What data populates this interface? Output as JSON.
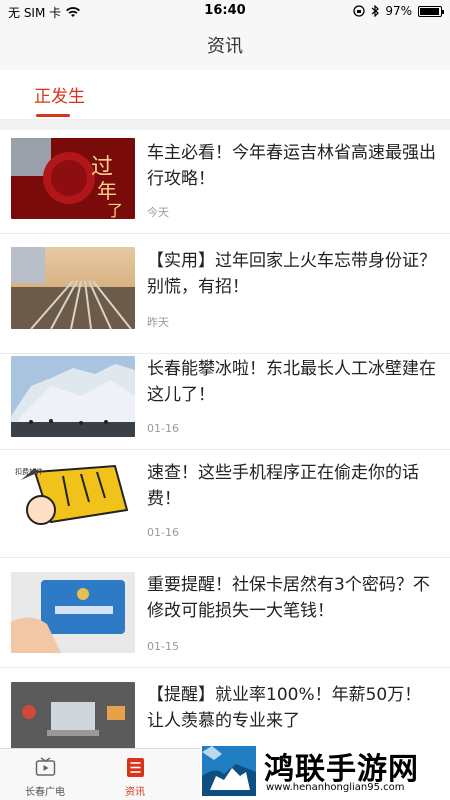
{
  "status_bar": {
    "carrier": "无 SIM 卡",
    "time": "16:40",
    "battery_percent_text": "97%",
    "battery_level": 0.97
  },
  "nav": {
    "title": "资讯"
  },
  "tabs": [
    {
      "label": "正发生",
      "active": true
    }
  ],
  "news": [
    {
      "title": "车主必看！今年春运吉林省高速最强出行攻略！",
      "date": "今天",
      "thumb_icon": "new-year-red-image"
    },
    {
      "title": "【实用】过年回家上火车忘带身份证？别慌，有招！",
      "date": "昨天",
      "thumb_icon": "train-station-image"
    },
    {
      "title": "长春能攀冰啦！东北最长人工冰壁建在这儿了！",
      "date": "01-16",
      "thumb_icon": "ice-wall-image"
    },
    {
      "title": "速查！这些手机程序正在偷走你的话费！",
      "date": "01-16",
      "thumb_icon": "phone-cartoon-image"
    },
    {
      "title": "重要提醒！社保卡居然有3个密码？不修改可能损失一大笔钱！",
      "date": "01-15",
      "thumb_icon": "social-security-card-image"
    },
    {
      "title": "【提醒】就业率100%！年薪50万！让人羡慕的专业来了",
      "date": "",
      "thumb_icon": "office-desk-image"
    }
  ],
  "bottom_tabs": [
    {
      "label": "长春广电",
      "icon": "tv-icon",
      "active": false
    },
    {
      "label": "资讯",
      "icon": "news-list-icon",
      "active": true
    }
  ],
  "watermark": {
    "title": "鸿联手游网",
    "url": "www.henanhonglian95.com"
  },
  "colors": {
    "accent": "#d9341a",
    "background": "#ffffff",
    "nav_background": "#f7f7f7"
  }
}
